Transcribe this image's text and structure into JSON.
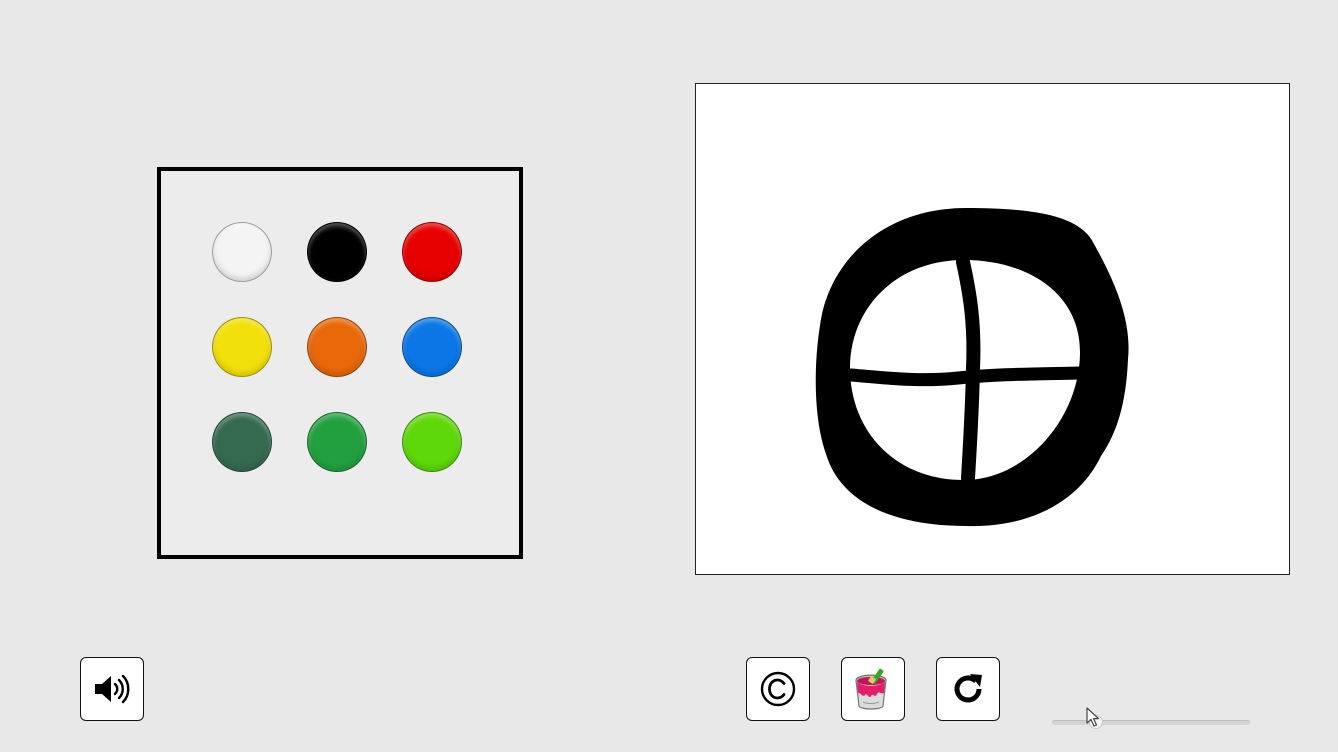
{
  "palette": {
    "swatches": [
      {
        "name": "white",
        "color": "#f4f4f4"
      },
      {
        "name": "black",
        "color": "#000000"
      },
      {
        "name": "red",
        "color": "#e60000"
      },
      {
        "name": "yellow",
        "color": "#f2e00c"
      },
      {
        "name": "orange",
        "color": "#e8680a"
      },
      {
        "name": "blue",
        "color": "#0b76e6"
      },
      {
        "name": "dark-green",
        "color": "#356a4f"
      },
      {
        "name": "green",
        "color": "#22a040"
      },
      {
        "name": "lime",
        "color": "#5fd80a"
      }
    ]
  },
  "canvas": {
    "background": "#ffffff",
    "stroke_color": "#000000"
  },
  "toolbar": {
    "sound_icon": "speaker-icon",
    "copyright_icon": "copyright-icon",
    "fill_icon": "paint-bucket-icon",
    "reset_icon": "refresh-icon"
  },
  "brush_size_slider": {
    "value": 0.2
  }
}
